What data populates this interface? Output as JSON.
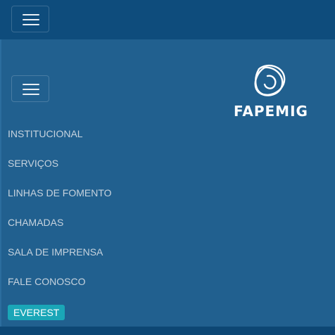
{
  "header": {
    "menu_icon": "hamburger-icon"
  },
  "main": {
    "menu_icon": "hamburger-icon",
    "logo": {
      "text": "FAPEMIG",
      "icon": "fapemig-logo-mark"
    },
    "nav_items": [
      {
        "label": "INSTITUCIONAL"
      },
      {
        "label": "SERVIÇOS"
      },
      {
        "label": "LINHAS DE FOMENTO"
      },
      {
        "label": "CHAMADAS"
      },
      {
        "label": "SALA DE IMPRENSA"
      },
      {
        "label": "FALE CONOSCO"
      }
    ],
    "everest_button": {
      "label": "EVEREST"
    }
  },
  "colors": {
    "topbar": "#0e4c7c",
    "background": "#21608f",
    "nav_text": "#c7d3de",
    "everest": "#1aa6b7"
  }
}
